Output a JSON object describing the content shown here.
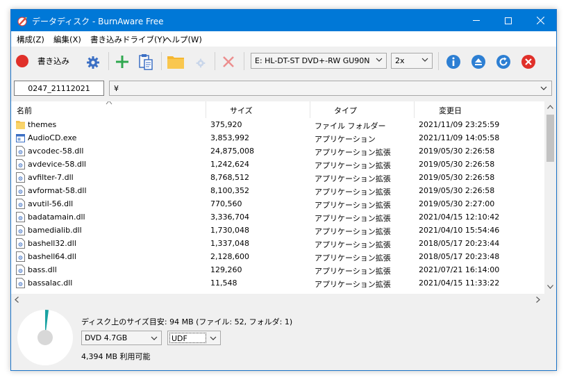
{
  "window": {
    "title": "データディスク - BurnAware Free"
  },
  "menu": [
    "構成(Z)",
    "編集(X)",
    "書き込みドライブ(Y)",
    "ヘルプ(W)"
  ],
  "toolbar": {
    "burn_label": "書き込み",
    "drive": "E: HL-DT-ST DVD+-RW GU90N",
    "speed": "2x"
  },
  "pathbar": {
    "disc_label": "0247_21112021",
    "path": "¥"
  },
  "columns": [
    "名前",
    "サイズ",
    "タイプ",
    "変更日"
  ],
  "files": [
    {
      "name": "themes",
      "size": "375,920",
      "type": "ファイル フォルダー",
      "date": "2021/11/09 23:25:59",
      "icon": "folder-icon"
    },
    {
      "name": "AudioCD.exe",
      "size": "3,853,992",
      "type": "アプリケーション",
      "date": "2021/11/09 14:05:58",
      "icon": "exe-icon"
    },
    {
      "name": "avcodec-58.dll",
      "size": "24,875,008",
      "type": "アプリケーション拡張",
      "date": "2019/05/30 2:26:58",
      "icon": "dll-icon"
    },
    {
      "name": "avdevice-58.dll",
      "size": "1,242,624",
      "type": "アプリケーション拡張",
      "date": "2019/05/30 2:26:58",
      "icon": "dll-icon"
    },
    {
      "name": "avfilter-7.dll",
      "size": "8,768,512",
      "type": "アプリケーション拡張",
      "date": "2019/05/30 2:26:58",
      "icon": "dll-icon"
    },
    {
      "name": "avformat-58.dll",
      "size": "8,100,352",
      "type": "アプリケーション拡張",
      "date": "2019/05/30 2:26:58",
      "icon": "dll-icon"
    },
    {
      "name": "avutil-56.dll",
      "size": "770,560",
      "type": "アプリケーション拡張",
      "date": "2019/05/30 2:27:00",
      "icon": "dll-icon"
    },
    {
      "name": "badatamain.dll",
      "size": "3,336,704",
      "type": "アプリケーション拡張",
      "date": "2021/04/15 12:10:42",
      "icon": "dll-icon"
    },
    {
      "name": "bamedialib.dll",
      "size": "1,730,048",
      "type": "アプリケーション拡張",
      "date": "2021/04/10 15:54:46",
      "icon": "dll-icon"
    },
    {
      "name": "bashell32.dll",
      "size": "1,337,048",
      "type": "アプリケーション拡張",
      "date": "2018/05/17 20:23:44",
      "icon": "dll-icon"
    },
    {
      "name": "bashell64.dll",
      "size": "2,128,600",
      "type": "アプリケーション拡張",
      "date": "2018/05/17 20:23:48",
      "icon": "dll-icon"
    },
    {
      "name": "bass.dll",
      "size": "129,260",
      "type": "アプリケーション拡張",
      "date": "2021/07/21 16:14:00",
      "icon": "dll-icon"
    },
    {
      "name": "bassalac.dll",
      "size": "11,548",
      "type": "アプリケーション拡張",
      "date": "2021/04/15 11:33:22",
      "icon": "dll-icon"
    }
  ],
  "status": {
    "size_text": "ディスク上のサイズ目安: 94 MB (ファイル: 52, フォルダ: 1)",
    "disc_type": "DVD 4.7GB",
    "file_system": "UDF",
    "available": "4,394 MB 利用可能",
    "used_fraction": 0.02
  },
  "colors": {
    "titlebar": "#0078d7",
    "burn": "#e0302a",
    "add": "#2fa84f",
    "info": "#2d7fd3",
    "gauge_used": "#1aa3a3"
  }
}
